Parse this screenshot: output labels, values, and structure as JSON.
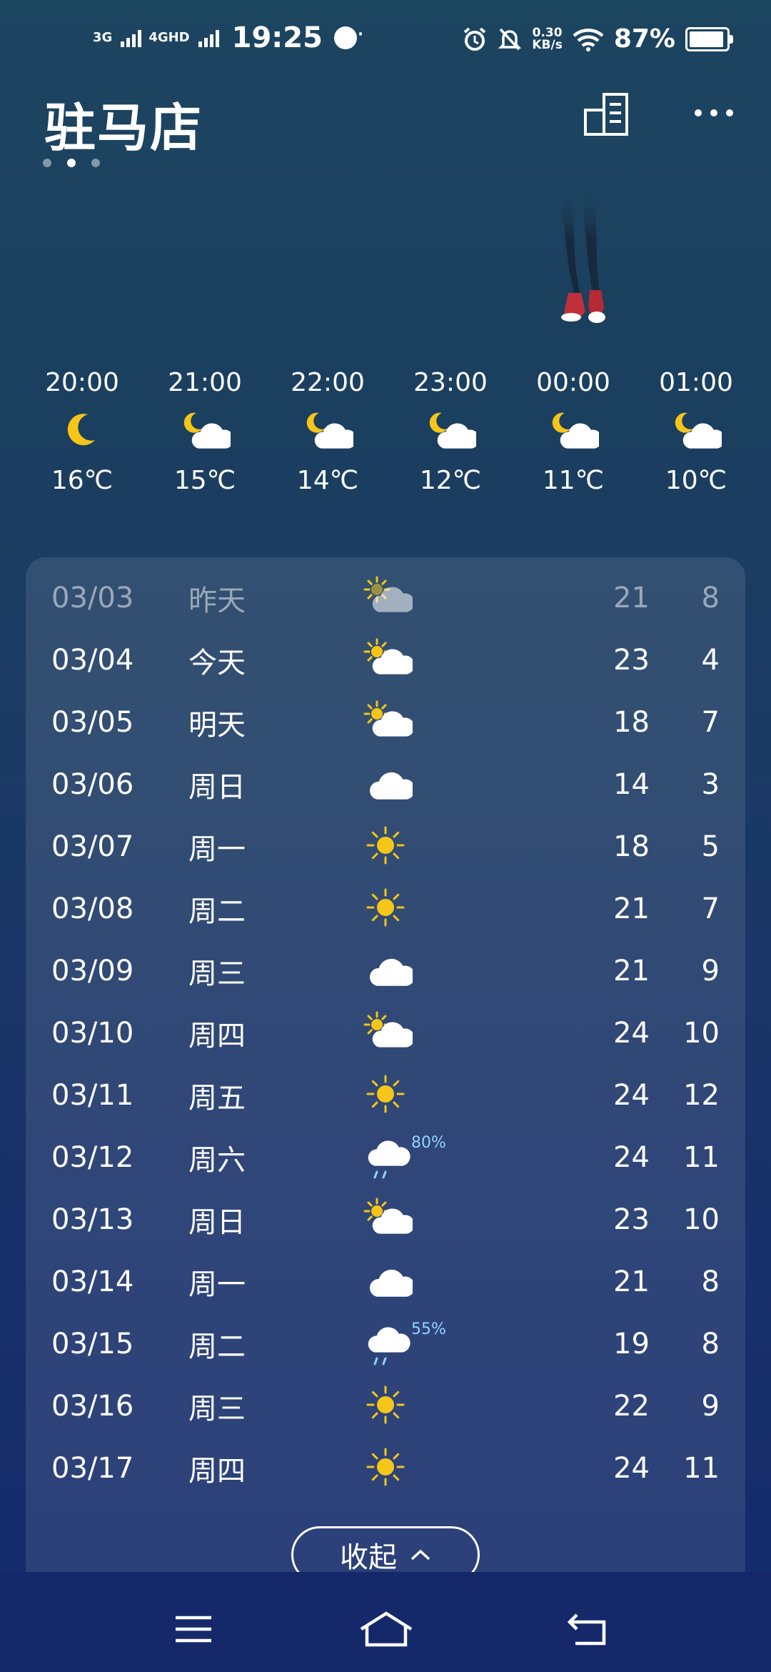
{
  "status": {
    "net1": "3G",
    "net2": "4GHD",
    "time": "19:25",
    "more": "···",
    "speed_val": "0.30",
    "speed_unit": "KB/s",
    "battery": "87%"
  },
  "header": {
    "city": "驻马店",
    "page_count": 3,
    "active_page": 1
  },
  "hourly": [
    {
      "time": "20:00",
      "icon": "moon-icon",
      "temp": "16℃"
    },
    {
      "time": "21:00",
      "icon": "partly-cloudy-night-icon",
      "temp": "15℃"
    },
    {
      "time": "22:00",
      "icon": "partly-cloudy-night-icon",
      "temp": "14℃"
    },
    {
      "time": "23:00",
      "icon": "partly-cloudy-night-icon",
      "temp": "12℃"
    },
    {
      "time": "00:00",
      "icon": "partly-cloudy-night-icon",
      "temp": "11℃"
    },
    {
      "time": "01:00",
      "icon": "partly-cloudy-night-icon",
      "temp": "10℃"
    }
  ],
  "daily": [
    {
      "date": "03/03",
      "day": "昨天",
      "icon": "partly-cloudy-icon",
      "high": "21",
      "low": "8",
      "dim": true
    },
    {
      "date": "03/04",
      "day": "今天",
      "icon": "partly-cloudy-icon",
      "high": "23",
      "low": "4"
    },
    {
      "date": "03/05",
      "day": "明天",
      "icon": "partly-cloudy-icon",
      "high": "18",
      "low": "7"
    },
    {
      "date": "03/06",
      "day": "周日",
      "icon": "cloud-icon",
      "high": "14",
      "low": "3"
    },
    {
      "date": "03/07",
      "day": "周一",
      "icon": "sun-icon",
      "high": "18",
      "low": "5"
    },
    {
      "date": "03/08",
      "day": "周二",
      "icon": "sun-icon",
      "high": "21",
      "low": "7"
    },
    {
      "date": "03/09",
      "day": "周三",
      "icon": "cloud-icon",
      "high": "21",
      "low": "9"
    },
    {
      "date": "03/10",
      "day": "周四",
      "icon": "partly-cloudy-icon",
      "high": "24",
      "low": "10"
    },
    {
      "date": "03/11",
      "day": "周五",
      "icon": "sun-icon",
      "high": "24",
      "low": "12"
    },
    {
      "date": "03/12",
      "day": "周六",
      "icon": "rain-icon",
      "precip": "80%",
      "high": "24",
      "low": "11"
    },
    {
      "date": "03/13",
      "day": "周日",
      "icon": "partly-cloudy-icon",
      "high": "23",
      "low": "10"
    },
    {
      "date": "03/14",
      "day": "周一",
      "icon": "cloud-icon",
      "high": "21",
      "low": "8"
    },
    {
      "date": "03/15",
      "day": "周二",
      "icon": "rain-icon",
      "precip": "55%",
      "high": "19",
      "low": "8"
    },
    {
      "date": "03/16",
      "day": "周三",
      "icon": "sun-icon",
      "high": "22",
      "low": "9"
    },
    {
      "date": "03/17",
      "day": "周四",
      "icon": "sun-icon",
      "high": "24",
      "low": "11"
    }
  ],
  "collapse_label": "收起",
  "colors": {
    "sun": "#f5c518",
    "cloud": "#ffffff",
    "precip": "#8fd3ff",
    "shoe": "#c0303a"
  }
}
